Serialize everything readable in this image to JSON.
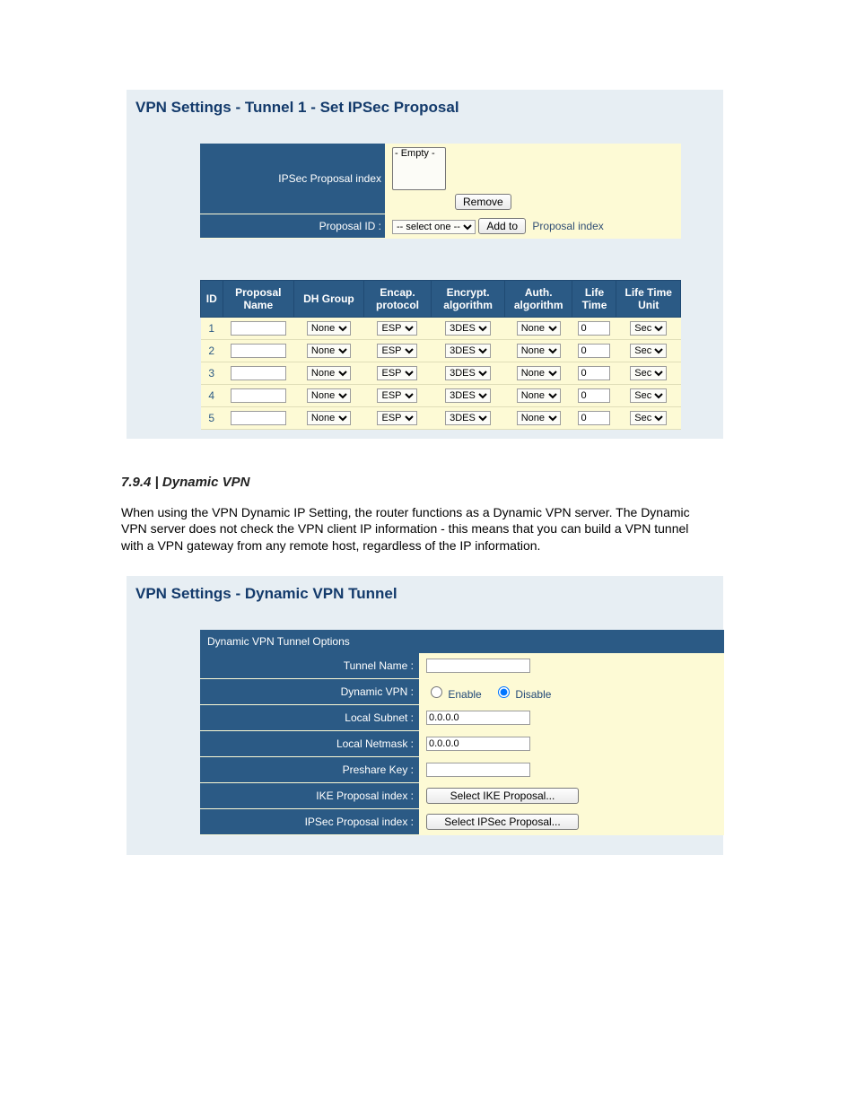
{
  "panel1": {
    "title": "VPN Settings - Tunnel 1 - Set IPSec Proposal",
    "ipsec_index_label": "IPSec Proposal index",
    "ipsec_index_option": "- Empty -",
    "remove_btn": "Remove",
    "proposal_id_label": "Proposal ID :",
    "proposal_id_select": "-- select one --",
    "addto_btn": "Add to",
    "proposal_id_after": "Proposal index",
    "grid": {
      "headers": {
        "id": "ID",
        "name": "Proposal Name",
        "dh": "DH Group",
        "encap": "Encap. protocol",
        "encrypt": "Encrypt. algorithm",
        "auth": "Auth. algorithm",
        "life": "Life Time",
        "lifeunit": "Life Time Unit"
      },
      "rows": [
        {
          "id": "1",
          "name": "",
          "dh": "None",
          "encap": "ESP",
          "encrypt": "3DES",
          "auth": "None",
          "life": "0",
          "unit": "Sec"
        },
        {
          "id": "2",
          "name": "",
          "dh": "None",
          "encap": "ESP",
          "encrypt": "3DES",
          "auth": "None",
          "life": "0",
          "unit": "Sec"
        },
        {
          "id": "3",
          "name": "",
          "dh": "None",
          "encap": "ESP",
          "encrypt": "3DES",
          "auth": "None",
          "life": "0",
          "unit": "Sec"
        },
        {
          "id": "4",
          "name": "",
          "dh": "None",
          "encap": "ESP",
          "encrypt": "3DES",
          "auth": "None",
          "life": "0",
          "unit": "Sec"
        },
        {
          "id": "5",
          "name": "",
          "dh": "None",
          "encap": "ESP",
          "encrypt": "3DES",
          "auth": "None",
          "life": "0",
          "unit": "Sec"
        }
      ]
    }
  },
  "section": {
    "heading": "7.9.4 | Dynamic VPN",
    "body": "When using the VPN Dynamic IP Setting, the router functions as a Dynamic VPN server. The Dynamic VPN server does not check the VPN client IP information - this means that you can build a VPN tunnel with a VPN gateway from any remote host, regardless of the IP information."
  },
  "panel2": {
    "title": "VPN Settings - Dynamic VPN Tunnel",
    "options_header": "Dynamic VPN Tunnel Options",
    "tunnel_name_label": "Tunnel Name :",
    "tunnel_name_value": "",
    "dynvpn_label": "Dynamic VPN :",
    "enable_label": "Enable",
    "disable_label": "Disable",
    "localsubnet_label": "Local Subnet :",
    "localsubnet_value": "0.0.0.0",
    "localnetmask_label": "Local Netmask :",
    "localnetmask_value": "0.0.0.0",
    "preshare_label": "Preshare Key :",
    "preshare_value": "",
    "ike_label": "IKE Proposal index :",
    "ike_btn": "Select IKE Proposal...",
    "ipsec_label": "IPSec Proposal index :",
    "ipsec_btn": "Select IPSec Proposal..."
  }
}
